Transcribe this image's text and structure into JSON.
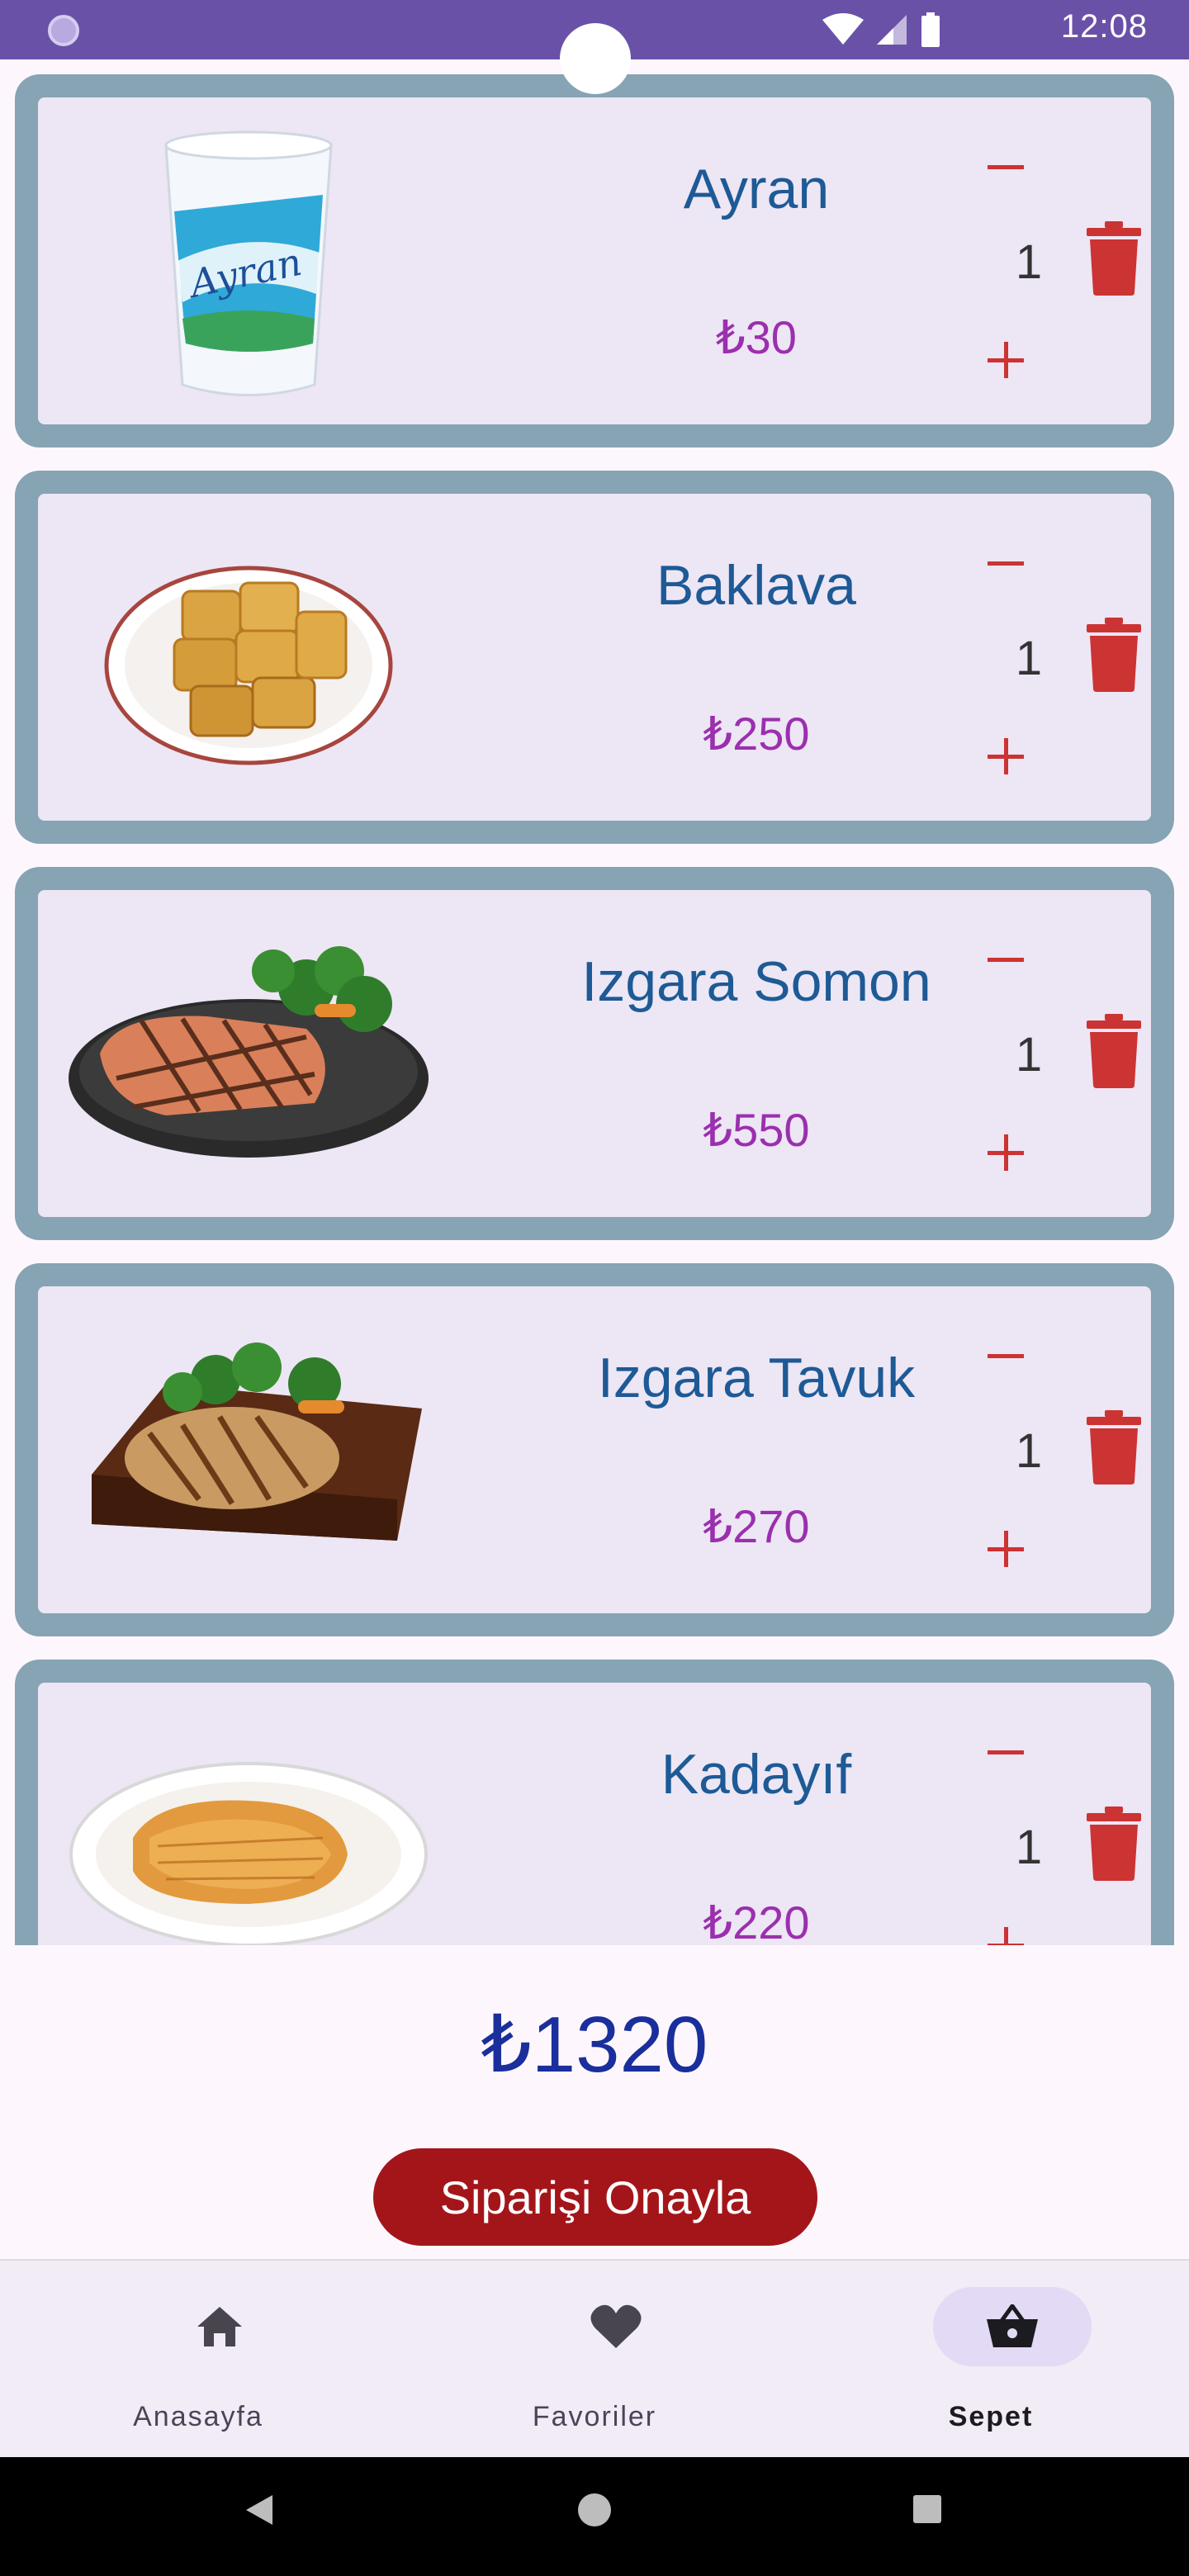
{
  "status_bar": {
    "time": "12:08"
  },
  "cart_items": [
    {
      "name": "Ayran",
      "price": "₺30",
      "quantity": "1"
    },
    {
      "name": "Baklava",
      "price": "₺250",
      "quantity": "1"
    },
    {
      "name": "Izgara Somon",
      "price": "₺550",
      "quantity": "1"
    },
    {
      "name": "Izgara Tavuk",
      "price": "₺270",
      "quantity": "1"
    },
    {
      "name": "Kadayıf",
      "price": "₺220",
      "quantity": "1"
    }
  ],
  "total": "₺1320",
  "confirm_label": "Siparişi Onayla",
  "bottom_nav": [
    {
      "label": "Anasayfa",
      "icon": "home-icon"
    },
    {
      "label": "Favoriler",
      "icon": "heart-icon"
    },
    {
      "label": "Sepet",
      "icon": "basket-icon",
      "active": true
    }
  ],
  "colors": {
    "header": "#6a51a8",
    "card_border": "#86a4b3",
    "card_fill": "#ede6f4",
    "item_name": "#1d5a96",
    "item_price": "#9b2faf",
    "accent_red": "#cc3333",
    "total": "#1a2e9c",
    "confirm_button": "#a4151a"
  }
}
